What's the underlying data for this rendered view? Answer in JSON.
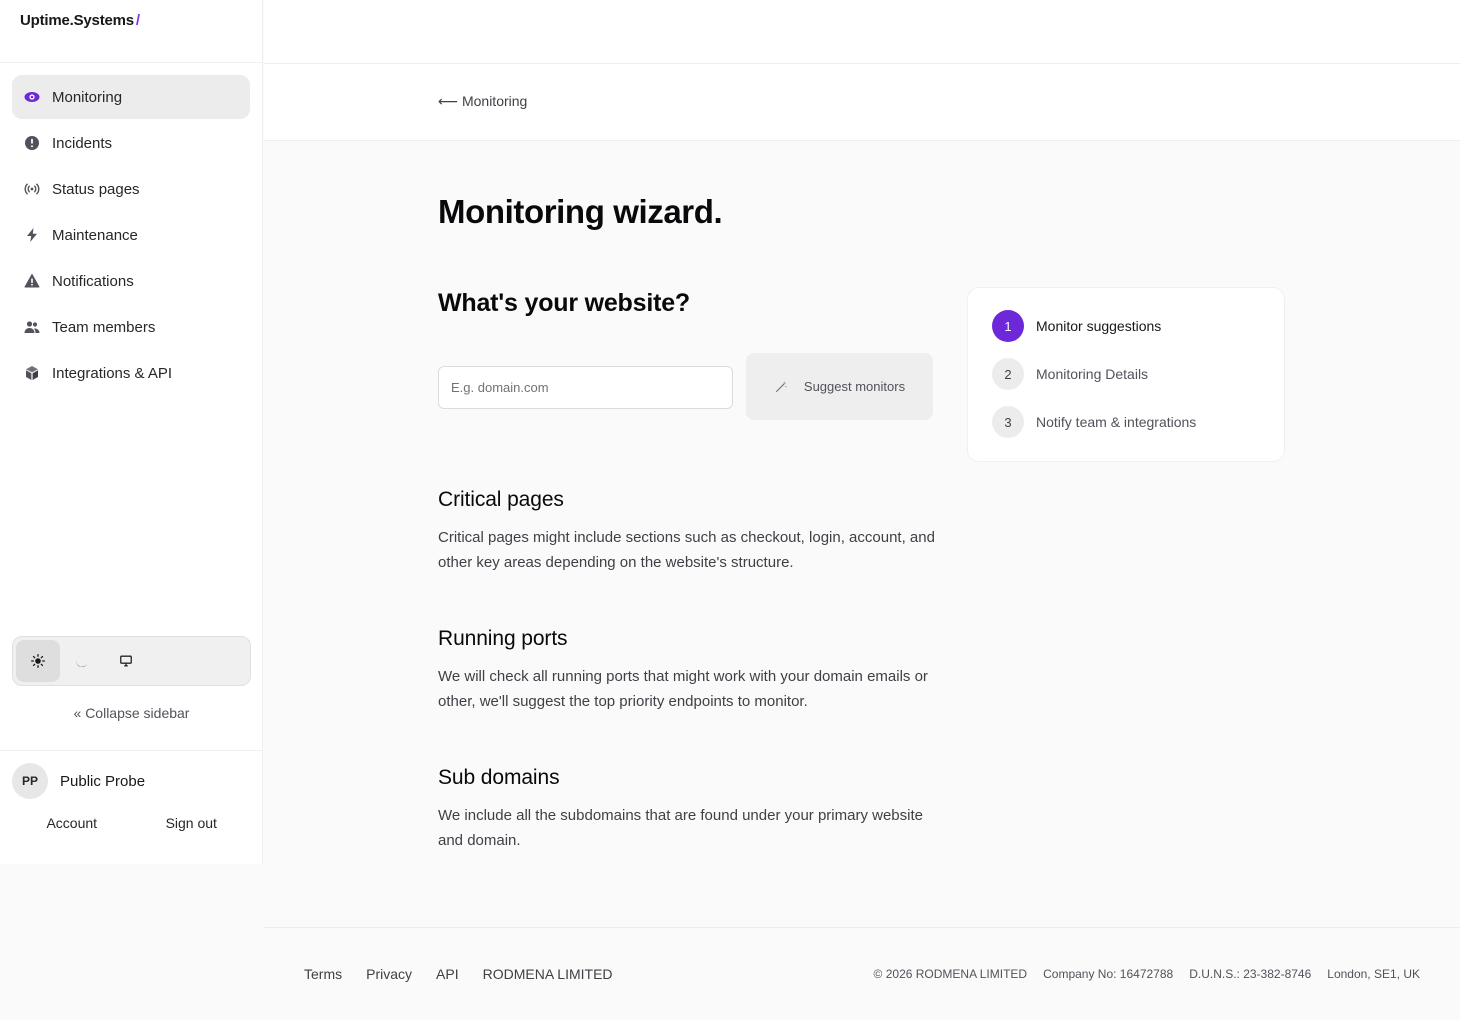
{
  "brand": {
    "name": "Uptime.Systems",
    "slash": "/"
  },
  "sidebar": {
    "items": [
      {
        "label": "Monitoring",
        "icon": "eye-icon"
      },
      {
        "label": "Incidents",
        "icon": "alert-circle-icon"
      },
      {
        "label": "Status pages",
        "icon": "broadcast-icon"
      },
      {
        "label": "Maintenance",
        "icon": "bolt-icon"
      },
      {
        "label": "Notifications",
        "icon": "warning-triangle-icon"
      },
      {
        "label": "Team members",
        "icon": "users-icon"
      },
      {
        "label": "Integrations & API",
        "icon": "cube-icon"
      }
    ],
    "collapse_label": "«  Collapse sidebar",
    "user": {
      "initials": "PP",
      "name": "Public Probe"
    },
    "account_label": "Account",
    "signout_label": "Sign out"
  },
  "header": {
    "back_label": "⟵ Monitoring"
  },
  "main": {
    "title": "Monitoring wizard.",
    "question": "What's your website?",
    "input_placeholder": "E.g. domain.com",
    "suggest_label": "Suggest monitors",
    "sections": [
      {
        "title": "Critical pages",
        "text": "Critical pages might include sections such as checkout, login, account, and other key areas depending on the website's structure."
      },
      {
        "title": "Running ports",
        "text": "We will check all running ports that might work with your domain emails or other, we'll suggest the top priority endpoints to monitor."
      },
      {
        "title": "Sub domains",
        "text": "We include all the subdomains that are found under your primary website and domain."
      }
    ]
  },
  "steps": [
    {
      "num": "1",
      "label": "Monitor suggestions"
    },
    {
      "num": "2",
      "label": "Monitoring Details"
    },
    {
      "num": "3",
      "label": "Notify team & integrations"
    }
  ],
  "footer": {
    "links": [
      "Terms",
      "Privacy",
      "API",
      "RODMENA LIMITED"
    ],
    "meta": [
      "© 2026 RODMENA LIMITED",
      "Company No: 16472788",
      "D.U.N.S.: 23-382-8746",
      "London, SE1, UK"
    ]
  },
  "colors": {
    "accent": "#6d28d9",
    "active_nav": "#ececec"
  }
}
